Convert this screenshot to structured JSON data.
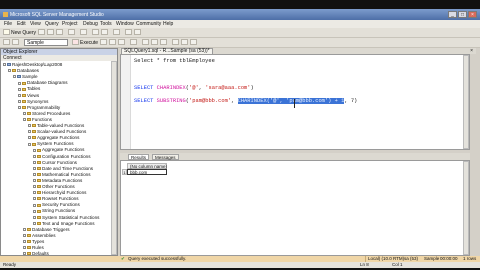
{
  "window": {
    "title": "Microsoft SQL Server Management Studio"
  },
  "menu": {
    "items": [
      "File",
      "Edit",
      "View",
      "Query",
      "Project",
      "Debug",
      "Tools",
      "Window",
      "Community",
      "Help"
    ]
  },
  "toolbar": {
    "new_query_label": "New Query",
    "execute_label": "Execute",
    "database_value": "Sample"
  },
  "object_explorer": {
    "title": "Object Explorer",
    "connect_label": "Connect",
    "tree": [
      {
        "label": "RajeshDesktop\\Lap2008",
        "level": 0,
        "folder": false,
        "expand": true
      },
      {
        "label": "Databases",
        "level": 1,
        "folder": true,
        "expand": true
      },
      {
        "label": "Sample",
        "level": 2,
        "folder": false,
        "expand": true
      },
      {
        "label": "Database Diagrams",
        "level": 3,
        "folder": true,
        "expand": true
      },
      {
        "label": "Tables",
        "level": 3,
        "folder": true,
        "expand": true
      },
      {
        "label": "Views",
        "level": 3,
        "folder": true,
        "expand": true
      },
      {
        "label": "Synonyms",
        "level": 3,
        "folder": true,
        "expand": true
      },
      {
        "label": "Programmability",
        "level": 3,
        "folder": true,
        "expand": true
      },
      {
        "label": "Stored Procedures",
        "level": 4,
        "folder": true,
        "expand": true
      },
      {
        "label": "Functions",
        "level": 4,
        "folder": true,
        "expand": true
      },
      {
        "label": "Table-valued Functions",
        "level": 5,
        "folder": true,
        "expand": true
      },
      {
        "label": "Scalar-valued Functions",
        "level": 5,
        "folder": true,
        "expand": true
      },
      {
        "label": "Aggregate Functions",
        "level": 5,
        "folder": true,
        "expand": true
      },
      {
        "label": "System Functions",
        "level": 5,
        "folder": true,
        "expand": true
      },
      {
        "label": "Aggregate Functions",
        "level": 6,
        "folder": true,
        "expand": true
      },
      {
        "label": "Configuration Functions",
        "level": 6,
        "folder": true,
        "expand": true
      },
      {
        "label": "Cursor Functions",
        "level": 6,
        "folder": true,
        "expand": true
      },
      {
        "label": "Date and Time Functions",
        "level": 6,
        "folder": true,
        "expand": true
      },
      {
        "label": "Mathematical Functions",
        "level": 6,
        "folder": true,
        "expand": true
      },
      {
        "label": "Metadata Functions",
        "level": 6,
        "folder": true,
        "expand": true
      },
      {
        "label": "Other Functions",
        "level": 6,
        "folder": true,
        "expand": true
      },
      {
        "label": "Hierarchyid Functions",
        "level": 6,
        "folder": true,
        "expand": true
      },
      {
        "label": "Rowset Functions",
        "level": 6,
        "folder": true,
        "expand": true
      },
      {
        "label": "Security Functions",
        "level": 6,
        "folder": true,
        "expand": true
      },
      {
        "label": "String Functions",
        "level": 6,
        "folder": true,
        "expand": true
      },
      {
        "label": "System Statistical Functions",
        "level": 6,
        "folder": true,
        "expand": true
      },
      {
        "label": "Text and Image Functions",
        "level": 6,
        "folder": true,
        "expand": true
      },
      {
        "label": "Database Triggers",
        "level": 4,
        "folder": true,
        "expand": true
      },
      {
        "label": "Assemblies",
        "level": 4,
        "folder": true,
        "expand": true
      },
      {
        "label": "Types",
        "level": 4,
        "folder": true,
        "expand": true
      },
      {
        "label": "Rules",
        "level": 4,
        "folder": true,
        "expand": true
      },
      {
        "label": "Defaults",
        "level": 4,
        "folder": true,
        "expand": true
      }
    ]
  },
  "editor": {
    "tab_label": "SQLQuery1.sql - R...Sample (sa (53))*",
    "lines": [
      {
        "parts": [
          {
            "t": "Select * from tblEmployee",
            "c": "plain"
          }
        ]
      },
      {
        "parts": [
          {
            "t": "SELECT ",
            "c": "kw"
          },
          {
            "t": "CHARINDEX",
            "c": "fn"
          },
          {
            "t": "(",
            "c": "plain"
          },
          {
            "t": "'@'",
            "c": "str"
          },
          {
            "t": ", ",
            "c": "plain"
          },
          {
            "t": "'sara@aaa.com'",
            "c": "str"
          },
          {
            "t": ")",
            "c": "plain"
          }
        ]
      },
      {
        "parts": [
          {
            "t": "SELECT ",
            "c": "kw"
          },
          {
            "t": "SUBSTRING",
            "c": "fn"
          },
          {
            "t": "(",
            "c": "plain"
          },
          {
            "t": "'pam@bbb.com'",
            "c": "str"
          },
          {
            "t": ", ",
            "c": "plain"
          },
          {
            "t": "CHARINDEX('@', 'pam@bbb.com') + 1",
            "c": "hl"
          },
          {
            "t": ", 7)",
            "c": "plain"
          }
        ]
      }
    ]
  },
  "results": {
    "tab_results": "Results",
    "tab_messages": "Messages",
    "column_header": "(No column name)",
    "row_number": "1",
    "cell_value": "bbb.com"
  },
  "status": {
    "message": "Query executed successfully.",
    "server": "Local) (10.0 RTM)",
    "user": "sa (53)",
    "database": "Sample",
    "time": "00:00:00",
    "rows": "1 rows"
  },
  "bottom": {
    "ready": "Ready",
    "ln": "Ln 8",
    "col": "Col 1"
  },
  "colors": {
    "selection": "#3b73d6",
    "keyword": "#1133ee",
    "function": "#d0109c",
    "string": "#c41a16",
    "status_bar": "#f0d6a7"
  }
}
